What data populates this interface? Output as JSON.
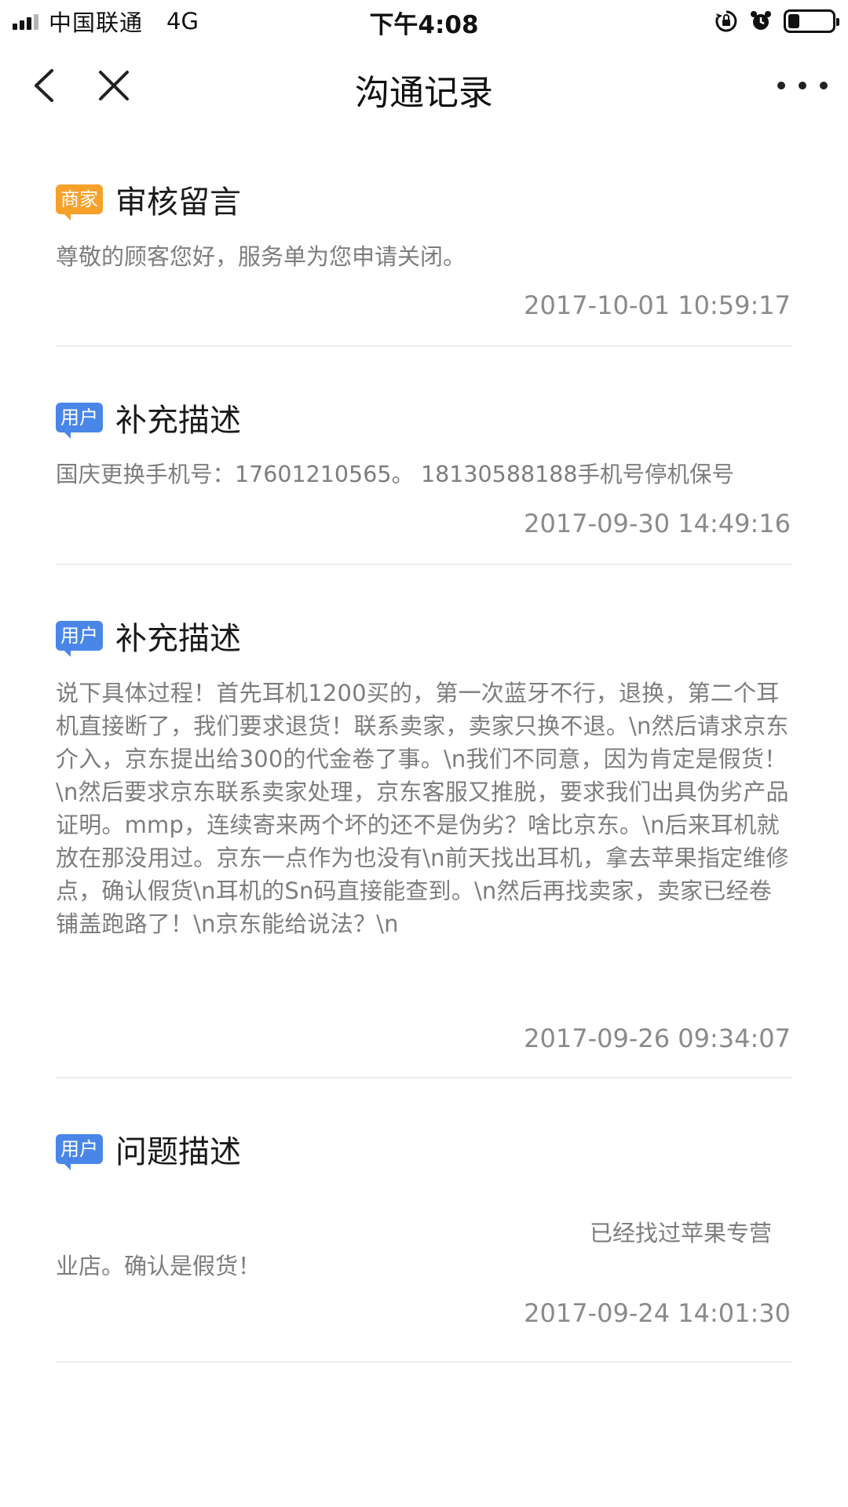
{
  "status_bar": {
    "carrier": "中国联通",
    "network": "4G",
    "time": "下午4:08",
    "icons": [
      "signal-icon",
      "rotation-lock-icon",
      "alarm-icon",
      "battery-icon"
    ]
  },
  "nav": {
    "title": "沟通记录",
    "icons": [
      "back-chevron-icon",
      "close-icon",
      "more-dots-icon"
    ]
  },
  "records": [
    {
      "badge": "商家",
      "badge_type": "merchant",
      "title": "审核留言",
      "body": "尊敬的顾客您好，服务单为您申请关闭。",
      "time": "2017-10-01 10:59:17"
    },
    {
      "badge": "用户",
      "badge_type": "user",
      "title": "补充描述",
      "body": "国庆更换手机号：17601210565。 18130588188手机号停机保号",
      "time": "2017-09-30 14:49:16"
    },
    {
      "badge": "用户",
      "badge_type": "user",
      "title": "补充描述",
      "body": "说下具体过程！首先耳机1200买的，第一次蓝牙不行，退换，第二个耳机直接断了，我们要求退货！联系卖家，卖家只换不退。\\n然后请求京东介入，京东提出给300的代金卷了事。\\n我们不同意，因为肯定是假货！\\n然后要求京东联系卖家处理，京东客服又推脱，要求我们出具伪劣产品证明。mmp，连续寄来两个坏的还不是伪劣？啥比京东。\\n后来耳机就放在那没用过。京东一点作为也没有\\n前天找出耳机，拿去苹果指定维修点，确认假货\\n耳机的Sn码直接能查到。\\n然后再找卖家，卖家已经卷铺盖跑路了！\\n京东能给说法？\\n",
      "time": "2017-09-26 09:34:07"
    },
    {
      "badge": "用户",
      "badge_type": "user",
      "title": "问题描述",
      "body_line1": "已经找过苹果专营",
      "body_line2": "业店。确认是假货！",
      "time": "2017-09-24 14:01:30"
    }
  ],
  "colors": {
    "merchant_badge": "#f6a12a",
    "user_badge": "#4a86e8",
    "body_text": "#7d7d7d",
    "divider": "#ececec"
  }
}
